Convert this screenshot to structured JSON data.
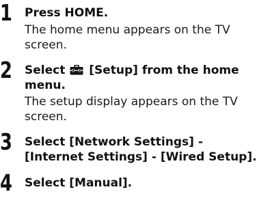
{
  "steps": [
    {
      "number": "1",
      "title_lines": [
        "Press HOME."
      ],
      "desc_lines": [
        "The home menu appears on the TV",
        "screen."
      ]
    },
    {
      "number": "2",
      "title_prefix": "Select",
      "title_icon": "toolbox-icon",
      "title_suffix": "[Setup] from the home",
      "title_line2": "menu.",
      "desc_lines": [
        "The setup display appears on the TV",
        "screen."
      ]
    },
    {
      "number": "3",
      "title_lines": [
        "Select [Network Settings] -",
        "[Internet Settings] - [Wired Setup]."
      ]
    },
    {
      "number": "4",
      "title_lines": [
        "Select [Manual]."
      ]
    }
  ]
}
